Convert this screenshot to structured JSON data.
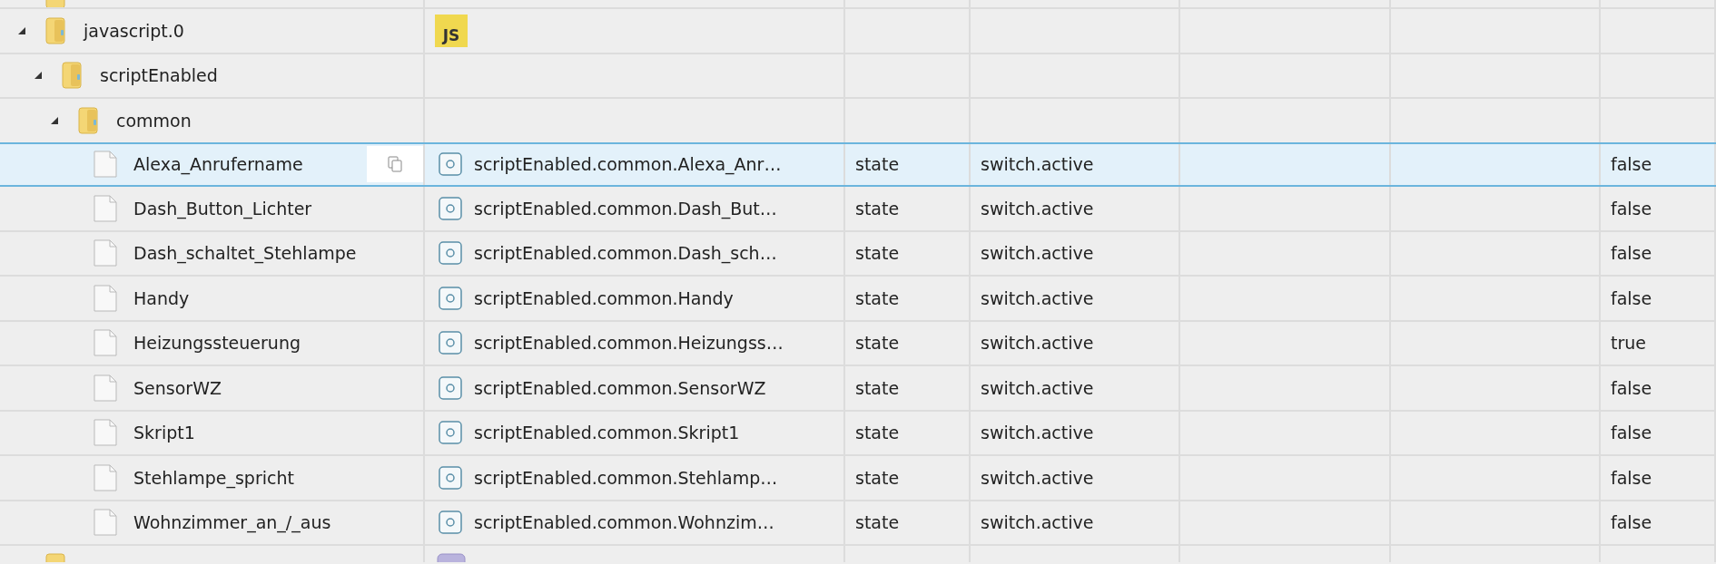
{
  "tree": [
    {
      "name": "javascript.0",
      "kind": "adapter",
      "badge": "JS",
      "expanded": true,
      "selected": false,
      "children": [
        {
          "name": "scriptEnabled",
          "kind": "folder",
          "expanded": true,
          "selected": false,
          "children": [
            {
              "name": "common",
              "kind": "folder",
              "expanded": true,
              "selected": false,
              "children": [
                {
                  "name": "Alexa_Anrufername",
                  "kind": "state",
                  "selected": true,
                  "id": "scriptEnabled.common.Alexa_Anr…",
                  "type": "state",
                  "role": "switch.active",
                  "value": "false"
                },
                {
                  "name": "Dash_Button_Lichter",
                  "kind": "state",
                  "selected": false,
                  "id": "scriptEnabled.common.Dash_But…",
                  "type": "state",
                  "role": "switch.active",
                  "value": "false"
                },
                {
                  "name": "Dash_schaltet_Stehlampe",
                  "kind": "state",
                  "selected": false,
                  "id": "scriptEnabled.common.Dash_sch…",
                  "type": "state",
                  "role": "switch.active",
                  "value": "false"
                },
                {
                  "name": "Handy",
                  "kind": "state",
                  "selected": false,
                  "id": "scriptEnabled.common.Handy",
                  "type": "state",
                  "role": "switch.active",
                  "value": "false"
                },
                {
                  "name": "Heizungssteuerung",
                  "kind": "state",
                  "selected": false,
                  "id": "scriptEnabled.common.Heizungss…",
                  "type": "state",
                  "role": "switch.active",
                  "value": "true"
                },
                {
                  "name": "SensorWZ",
                  "kind": "state",
                  "selected": false,
                  "id": "scriptEnabled.common.SensorWZ",
                  "type": "state",
                  "role": "switch.active",
                  "value": "false"
                },
                {
                  "name": "Skript1",
                  "kind": "state",
                  "selected": false,
                  "id": "scriptEnabled.common.Skript1",
                  "type": "state",
                  "role": "switch.active",
                  "value": "false"
                },
                {
                  "name": "Stehlampe_spricht",
                  "kind": "state",
                  "selected": false,
                  "id": "scriptEnabled.common.Stehlamp…",
                  "type": "state",
                  "role": "switch.active",
                  "value": "false"
                },
                {
                  "name": "Wohnzimmer_an_/_aus",
                  "kind": "state",
                  "selected": false,
                  "id": "scriptEnabled.common.Wohnzim…",
                  "type": "state",
                  "role": "switch.active",
                  "value": "false"
                }
              ]
            }
          ]
        }
      ]
    }
  ]
}
